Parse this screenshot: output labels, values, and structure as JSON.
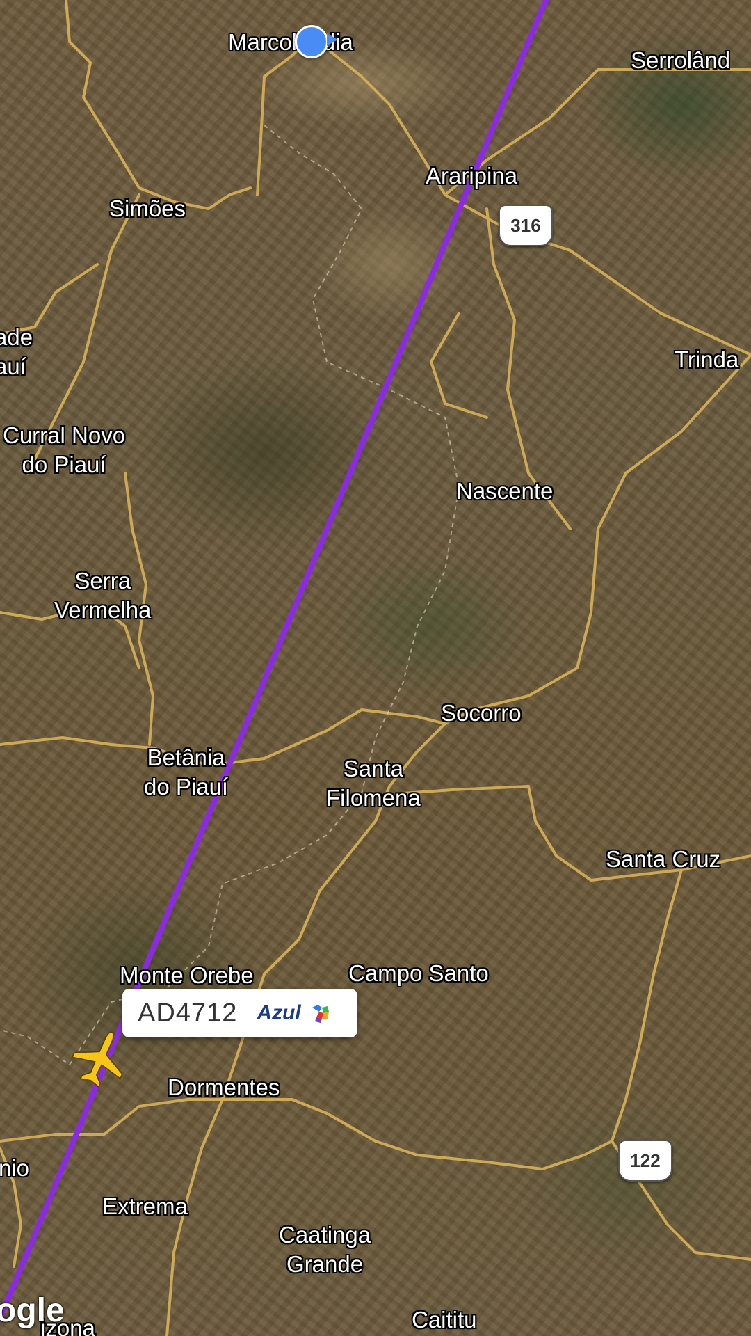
{
  "map": {
    "places": [
      {
        "id": "marcolandia",
        "lines": [
          "Marcolândia"
        ]
      },
      {
        "id": "serrolandia",
        "lines": [
          "Serrolând"
        ]
      },
      {
        "id": "araripina",
        "lines": [
          "Araripina"
        ]
      },
      {
        "id": "simoes",
        "lines": [
          "Simões"
        ]
      },
      {
        "id": "ade-piaui",
        "lines": [
          "ade",
          "auí"
        ]
      },
      {
        "id": "trindade",
        "lines": [
          "Trinda"
        ]
      },
      {
        "id": "curral-novo",
        "lines": [
          "Curral Novo",
          "do Piauí"
        ]
      },
      {
        "id": "nascente",
        "lines": [
          "Nascente"
        ]
      },
      {
        "id": "serra-vermelha",
        "lines": [
          "Serra",
          "Vermelha"
        ]
      },
      {
        "id": "socorro",
        "lines": [
          "Socorro"
        ]
      },
      {
        "id": "betania",
        "lines": [
          "Betânia",
          "do Piauí"
        ]
      },
      {
        "id": "santa-filomena",
        "lines": [
          "Santa",
          "Filomena"
        ]
      },
      {
        "id": "santa-cruz",
        "lines": [
          "Santa Cruz"
        ]
      },
      {
        "id": "monte-orebe",
        "lines": [
          "Monte Orebe"
        ]
      },
      {
        "id": "campo-santo",
        "lines": [
          "Campo Santo"
        ]
      },
      {
        "id": "dormentes",
        "lines": [
          "Dormentes"
        ]
      },
      {
        "id": "nio",
        "lines": [
          "nio"
        ]
      },
      {
        "id": "extrema",
        "lines": [
          "Extrema"
        ]
      },
      {
        "id": "caatinga-grande",
        "lines": [
          "Caatinga",
          "Grande"
        ]
      },
      {
        "id": "caititu",
        "lines": [
          "Caititu"
        ]
      },
      {
        "id": "izona",
        "lines": [
          "izona"
        ]
      }
    ],
    "road_shields": [
      "316",
      "122"
    ],
    "watermark": "ogle",
    "route_color": "#8a2be2",
    "road_color": "#d8b25a"
  },
  "flight": {
    "code": "AD4712",
    "airline": "Azul",
    "plane_color": "#f5c518"
  }
}
